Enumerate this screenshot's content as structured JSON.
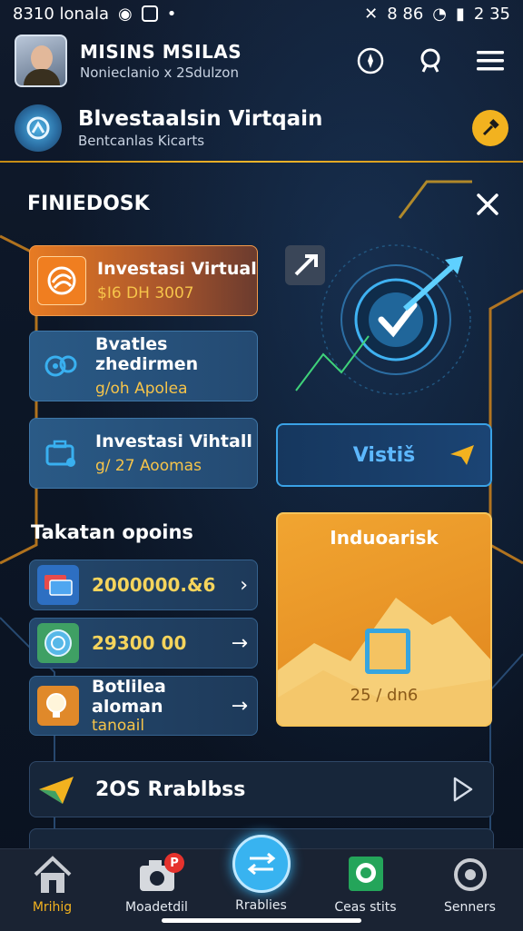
{
  "status_bar": {
    "left_text": "8310 lonala",
    "right_text": "8 86",
    "time": "2 35"
  },
  "header": {
    "name": "MISINS MSILAS",
    "subtitle": "Nonieclanio x 2Sdulzon"
  },
  "app": {
    "title": "Blvestaalsin Virtqain",
    "subtitle": "Bentcanlas Kicarts"
  },
  "panel": {
    "title": "FINIEDOSK",
    "cards": [
      {
        "title": "Investasi Virtual",
        "value": "$I6 DH 3007"
      },
      {
        "title": "Bvatles zhedirmen",
        "value": "g/oh Apolea"
      },
      {
        "title": "Investasi Vihtall",
        "value": "g/ 27 Aoomas"
      }
    ],
    "section_title": "Takatan opoins",
    "rows": [
      {
        "value": "2000000.&6",
        "arrow": "›"
      },
      {
        "value": "29300 00",
        "arrow": "→"
      },
      {
        "line1": "Botlilea aloman",
        "line2": "tanoail",
        "arrow": "→"
      }
    ],
    "visit_button": "Vistiš",
    "orange_card": {
      "title": "Induoarisk",
      "value": "25 / dn6"
    }
  },
  "promo": {
    "label": "2OS Rrablbss"
  },
  "nav": [
    {
      "label": "Mrihig",
      "active": true
    },
    {
      "label": "Moadetdil",
      "badge": "P"
    },
    {
      "label": "Rrablies"
    },
    {
      "label": "Ceas stits"
    },
    {
      "label": "Senners"
    }
  ],
  "colors": {
    "accent": "#f2b21f",
    "primary_blue": "#38b3f0",
    "card_orange": "#e77b23"
  }
}
